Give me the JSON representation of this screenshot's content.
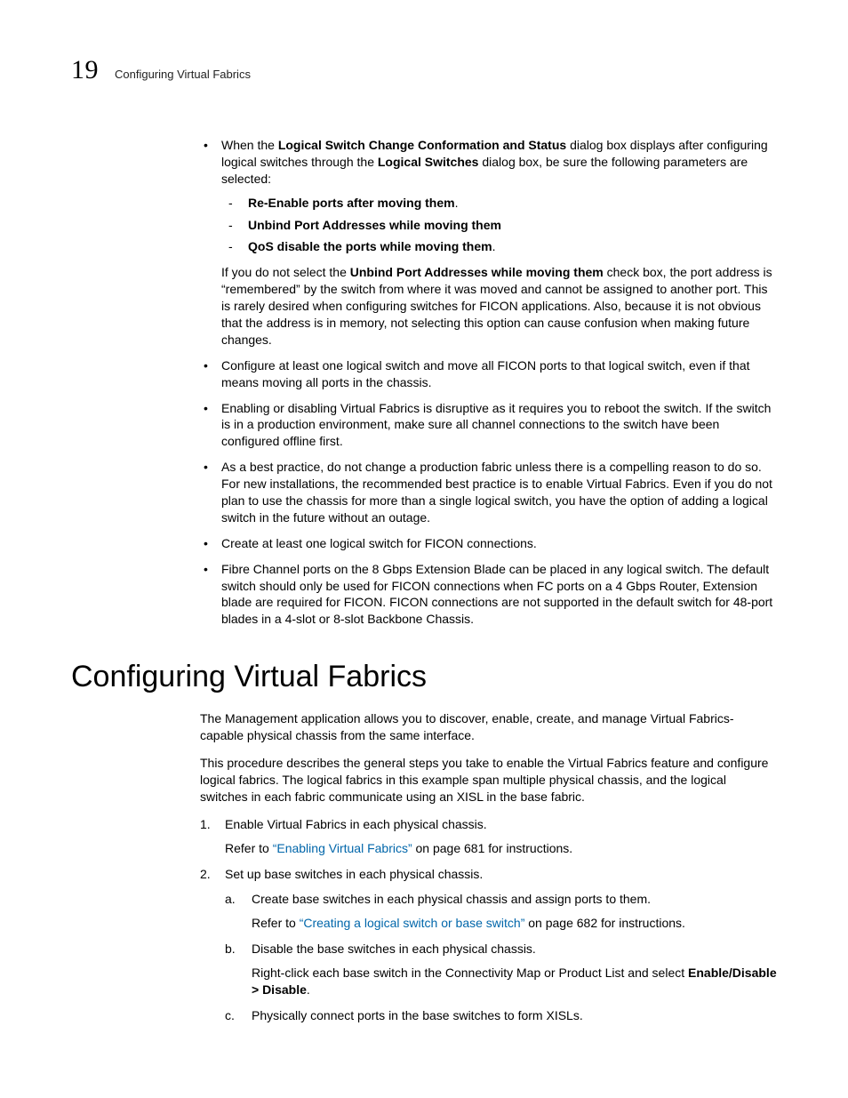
{
  "header": {
    "chapter_number": "19",
    "running_title": "Configuring Virtual Fabrics"
  },
  "bullets1": {
    "b0": {
      "pre": "When the ",
      "bold1": "Logical Switch Change Conformation and Status",
      "mid1": " dialog box displays after configuring logical switches through the ",
      "bold2": "Logical Switches",
      "post": " dialog box, be sure the following parameters are selected:",
      "dash1": "Re-Enable ports after moving them",
      "dash1_post": ".",
      "dash2": "Unbind Port Addresses while moving them",
      "dash3": "QoS disable the ports while moving them",
      "dash3_post": ".",
      "note_pre": "If you do not select the ",
      "note_bold": "Unbind Port Addresses while moving them",
      "note_post": " check box, the port address is “remembered” by the switch from where it was moved and cannot be assigned to another port. This is rarely desired when configuring switches for FICON applications. Also, because it is not obvious that the address is in memory, not selecting this option can cause confusion when making future changes."
    },
    "b1": "Configure at least one logical switch and move all FICON ports to that logical switch, even if that means moving all ports in the chassis.",
    "b2": "Enabling or disabling Virtual Fabrics is disruptive as it requires you to reboot the switch. If the switch is in a production environment, make sure all channel connections to the switch have been configured offline first.",
    "b3": "As a best practice, do not change a production fabric unless there is a compelling reason to do so. For new installations, the recommended best practice is to enable Virtual Fabrics. Even if you do not plan to use the chassis for more than a single logical switch, you have the option of adding a logical switch in the future without an outage.",
    "b4": "Create at least one logical switch for FICON connections.",
    "b5": "Fibre Channel ports on the 8 Gbps Extension Blade can be placed in any logical switch. The default switch should only be used for FICON connections when FC ports on a 4 Gbps Router, Extension blade are required for FICON. FICON connections are not supported in the default switch for 48-port blades in a 4-slot or 8-slot Backbone Chassis."
  },
  "section_title": "Configuring Virtual Fabrics",
  "intro1": "The Management application allows you to discover, enable, create, and manage Virtual Fabrics-capable physical chassis from the same interface.",
  "intro2": "This procedure describes the general steps you take to enable the Virtual Fabrics feature and configure logical fabrics. The logical fabrics in this example span multiple physical chassis, and the logical switches in each fabric communicate using an XISL in the base fabric.",
  "steps": {
    "s1": {
      "num": "1.",
      "text": "Enable Virtual Fabrics in each physical chassis.",
      "ref_pre": "Refer to ",
      "ref_link": "“Enabling Virtual Fabrics”",
      "ref_post": " on page 681 for instructions."
    },
    "s2": {
      "num": "2.",
      "text": "Set up base switches in each physical chassis.",
      "a": {
        "let": "a.",
        "text": "Create base switches in each physical chassis and assign ports to them.",
        "ref_pre": "Refer to ",
        "ref_link": "“Creating a logical switch or base switch”",
        "ref_post": " on page 682 for instructions."
      },
      "b": {
        "let": "b.",
        "text": "Disable the base switches in each physical chassis.",
        "detail_pre": "Right-click each base switch in the Connectivity Map or Product List and select ",
        "detail_bold": "Enable/Disable > Disable",
        "detail_post": "."
      },
      "c": {
        "let": "c.",
        "text": "Physically connect ports in the base switches to form XISLs."
      }
    }
  }
}
